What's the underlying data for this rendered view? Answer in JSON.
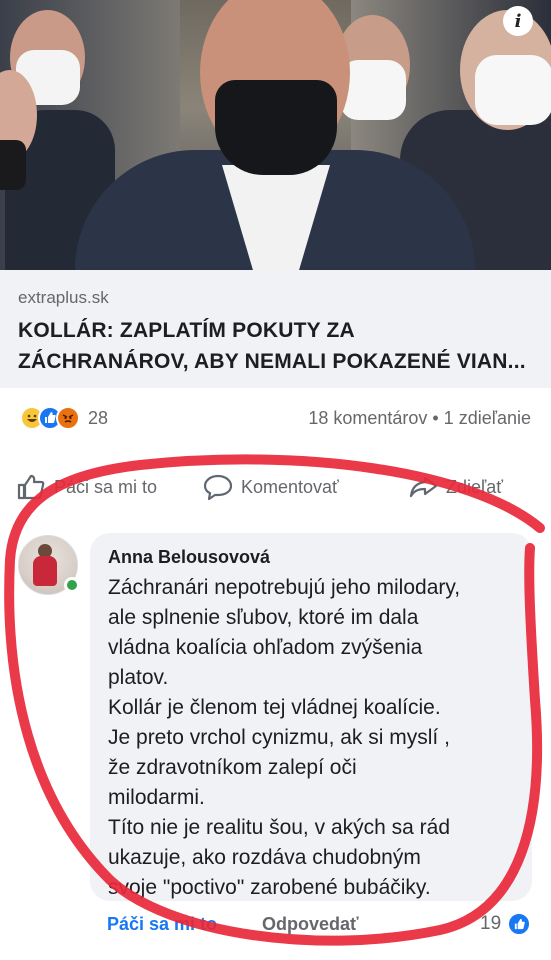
{
  "post": {
    "link_domain": "extraplus.sk",
    "link_title_line1": "KOLLÁR: ZAPLATÍM POKUTY ZA",
    "link_title_line2": "ZÁCHRANÁROV, ABY NEMALI POKAZENÉ VIAN...",
    "info_icon": "i"
  },
  "stats": {
    "reaction_count": "28",
    "comments_shares": "18 komentárov • 1 zdieľanie"
  },
  "actions": {
    "like_label": "Páči sa mi to",
    "comment_label": "Komentovať",
    "share_label": "Zdieľať"
  },
  "comment": {
    "author": "Anna Belousovová",
    "lines": [
      "Záchranári nepotrebujú jeho milodary,",
      "ale splnenie sľubov, ktoré im dala",
      "vládna koalícia ohľadom zvýšenia",
      "platov.",
      "Kollár je členom tej vládnej koalície.",
      "Je preto vrchol cynizmu, ak si myslí ,",
      "že zdravotníkom zalepí oči",
      "milodarmi.",
      "Títo nie je realitu šou, v akých sa rád",
      "ukazuje, ako rozdáva chudobným",
      "svoje \"poctivo\" zarobené bubáčiky."
    ],
    "like_label": "Páči sa mi to",
    "reply_label": "Odpovedať",
    "like_count": "19"
  },
  "colors": {
    "accent": "#1877f2",
    "annotation_red": "#e8283a",
    "online": "#31a24c"
  }
}
